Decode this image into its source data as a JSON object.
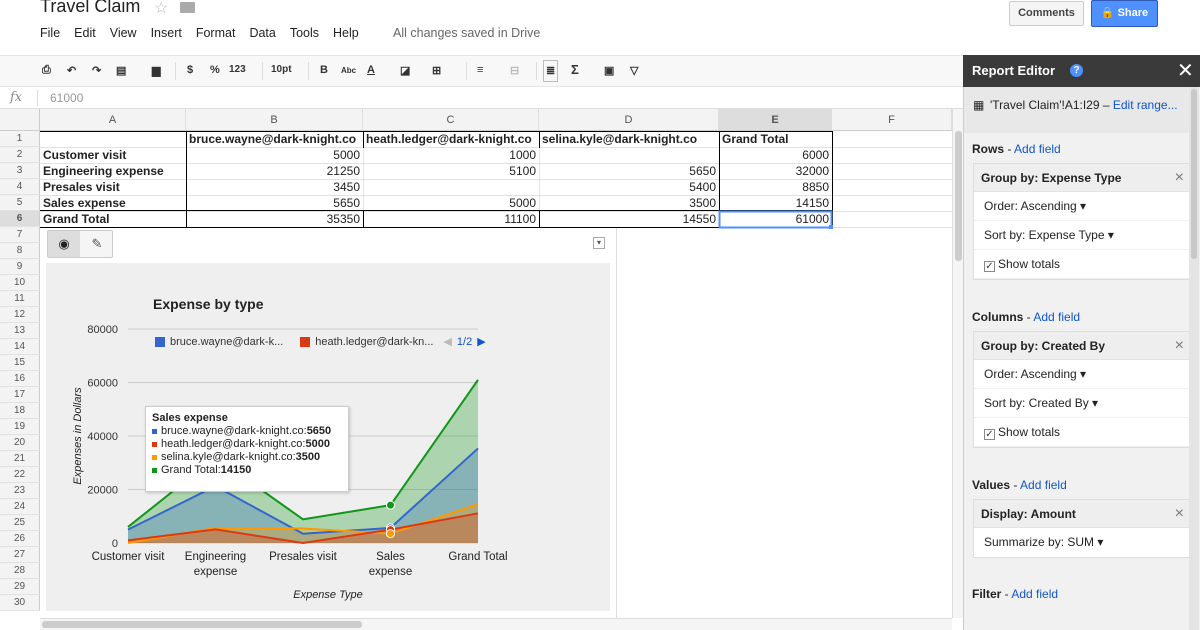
{
  "doc": {
    "title": "Travel Claim",
    "saved_status": "All changes saved in Drive"
  },
  "menu": [
    "File",
    "Edit",
    "View",
    "Insert",
    "Format",
    "Data",
    "Tools",
    "Help"
  ],
  "header_buttons": {
    "comments": "Comments",
    "share": "Share"
  },
  "toolbar": {
    "currency": "$",
    "percent": "%",
    "number_format": "123",
    "font_size": "10pt",
    "bold": "B",
    "spell": "Abc",
    "text_color": "A",
    "sigma": "Σ"
  },
  "formula_bar": {
    "fx": "fx",
    "value": "61000"
  },
  "columns": [
    "A",
    "B",
    "C",
    "D",
    "E",
    "F"
  ],
  "row_numbers": [
    "1",
    "2",
    "3",
    "4",
    "5",
    "6",
    "7",
    "8",
    "9",
    "10",
    "11",
    "12",
    "13",
    "14",
    "15",
    "16",
    "17",
    "18",
    "19",
    "20",
    "21",
    "22",
    "23",
    "24",
    "25",
    "26",
    "27",
    "28",
    "29",
    "30"
  ],
  "table": {
    "headers": [
      "",
      "bruce.wayne@dark-knight.co",
      "heath.ledger@dark-knight.co",
      "selina.kyle@dark-knight.co",
      "Grand Total"
    ],
    "rows": [
      [
        "Customer visit",
        "5000",
        "1000",
        "",
        "6000"
      ],
      [
        "Engineering expense",
        "21250",
        "5100",
        "5650",
        "32000"
      ],
      [
        "Presales visit",
        "3450",
        "",
        "5400",
        "8850"
      ],
      [
        "Sales expense",
        "5650",
        "5000",
        "3500",
        "14150"
      ],
      [
        "Grand Total",
        "35350",
        "11100",
        "14550",
        "61000"
      ]
    ]
  },
  "chart_data": {
    "type": "area",
    "title": "Expense by type",
    "xlabel": "Expense Type",
    "ylabel": "Expenses in Dollars",
    "categories": [
      "Customer visit",
      "Engineering expense",
      "Presales visit",
      "Sales expense",
      "Grand Total"
    ],
    "category_lines": [
      [
        "Customer visit"
      ],
      [
        "Engineering",
        "expense"
      ],
      [
        "Presales visit"
      ],
      [
        "Sales",
        "expense"
      ],
      [
        "Grand Total"
      ]
    ],
    "yticks": [
      "0",
      "20000",
      "40000",
      "60000",
      "80000"
    ],
    "ylim": [
      0,
      80000
    ],
    "series": [
      {
        "name": "bruce.wayne@dark-k...",
        "full_name": "bruce.wayne@dark-knight.co",
        "color": "#3366cc",
        "values": [
          5000,
          21250,
          3450,
          5650,
          35350
        ]
      },
      {
        "name": "heath.ledger@dark-kn...",
        "full_name": "heath.ledger@dark-knight.co",
        "color": "#dc3912",
        "values": [
          1000,
          5100,
          0,
          5000,
          11100
        ]
      },
      {
        "name": "selina.kyle@dark-knight.co",
        "full_name": "selina.kyle@dark-knight.co",
        "color": "#ff9900",
        "values": [
          0,
          5650,
          5400,
          3500,
          14550
        ]
      },
      {
        "name": "Grand Total",
        "full_name": "Grand Total",
        "color": "#109618",
        "values": [
          6000,
          32000,
          8850,
          14150,
          61000
        ]
      }
    ],
    "legend_page": "1/2",
    "legend": "top",
    "tooltip": {
      "title": "Sales expense",
      "rows": [
        {
          "label": "bruce.wayne@dark-knight.co: ",
          "value": "5650",
          "color": "#3366cc"
        },
        {
          "label": "heath.ledger@dark-knight.co: ",
          "value": "5000",
          "color": "#dc3912"
        },
        {
          "label": "selina.kyle@dark-knight.co: ",
          "value": "3500",
          "color": "#ff9900"
        },
        {
          "label": "Grand Total: ",
          "value": "14150",
          "color": "#109618"
        }
      ]
    }
  },
  "editor": {
    "title": "Report Editor",
    "range": "'Travel Claim'!A1:I29",
    "range_sep": " – ",
    "edit_range": "Edit range...",
    "add_field": "Add field",
    "rows_label": "Rows",
    "columns_label": "Columns",
    "values_label": "Values",
    "filter_label": "Filter",
    "sep": " - ",
    "rows_card": {
      "header": "Group by: Expense Type",
      "order": "Order: Ascending",
      "sort": "Sort by: Expense Type",
      "totals": "Show totals"
    },
    "columns_card": {
      "header": "Group by: Created By",
      "order": "Order: Ascending",
      "sort": "Sort by: Created By",
      "totals": "Show totals"
    },
    "values_card": {
      "header": "Display: Amount",
      "summarize": "Summarize by: SUM"
    }
  }
}
